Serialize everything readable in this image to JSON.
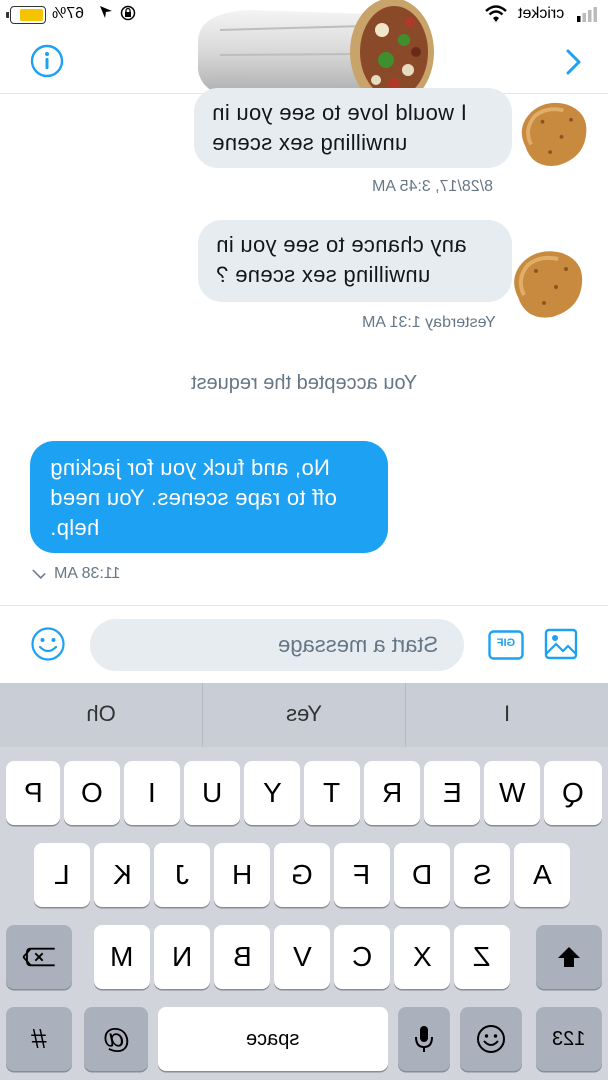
{
  "status": {
    "battery_pct": "67%",
    "battery_level": 0.67,
    "carrier": "cricket"
  },
  "header": {
    "info_icon": "info-circle-icon",
    "chevron_icon": "chevron-right-icon",
    "avatar": "burrito-image",
    "accent": "#1da1f2"
  },
  "messages": [
    {
      "direction": "in",
      "text_lines": [
        "I would love to see you in",
        "unwilling sex scene"
      ],
      "timestamp": "8/28/17, 3:45 AM",
      "avatar": "potato-emoji"
    },
    {
      "direction": "in",
      "text_lines": [
        "any chance to see you in",
        "unwilling sex scene ?"
      ],
      "timestamp": "Yesterday 1:31 AM",
      "avatar": "potato-emoji"
    }
  ],
  "system_message": "You accepted the request",
  "reply": {
    "direction": "out",
    "text_lines": [
      "No, and fuck you for jacking",
      "off to rape scenes. You need",
      "help."
    ],
    "timestamp": "11:38 AM",
    "status_icon": "checkmark-icon"
  },
  "composer": {
    "placeholder": "Start a message",
    "gif_label": "GIF",
    "emoji_icon": "smiley-icon",
    "image_icon": "image-icon"
  },
  "keyboard": {
    "predictions": [
      "I",
      "Yes",
      "Oh"
    ],
    "row1": [
      "Q",
      "W",
      "E",
      "R",
      "T",
      "Y",
      "U",
      "I",
      "O",
      "P"
    ],
    "row2": [
      "A",
      "S",
      "D",
      "F",
      "G",
      "H",
      "J",
      "K",
      "L"
    ],
    "row3": [
      "Z",
      "X",
      "C",
      "V",
      "B",
      "N",
      "M"
    ],
    "numbers_label": "123",
    "space_label": "space",
    "hash_label": "#",
    "at_label": "@",
    "shift_icon": "shift-icon",
    "backspace_icon": "backspace-icon",
    "emoji_icon": "emoji-icon",
    "mic_icon": "microphone-icon"
  }
}
